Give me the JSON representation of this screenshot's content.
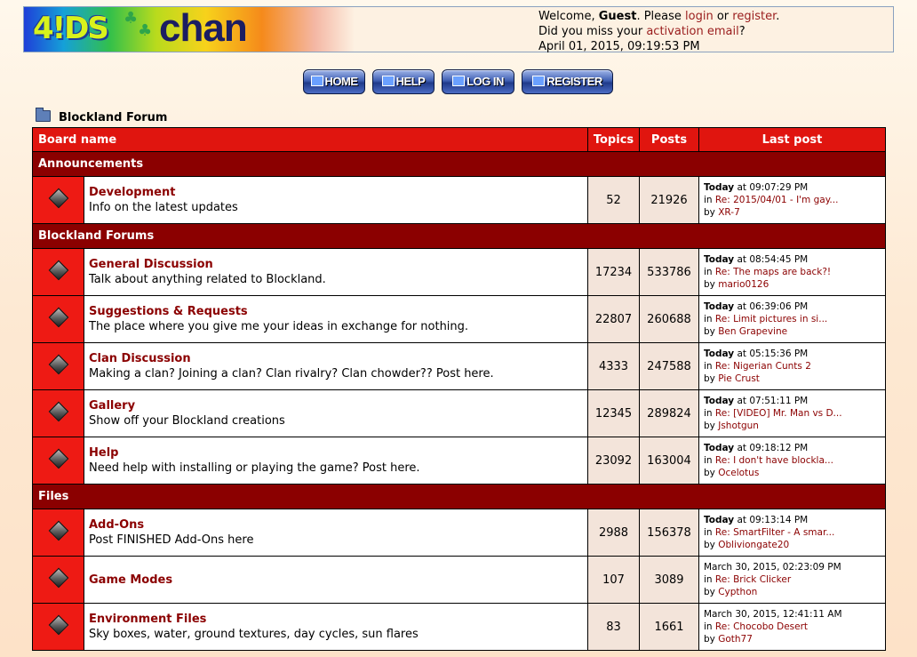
{
  "header": {
    "logo_text_1": "4!DS",
    "logo_text_2": "chan",
    "welcome_prefix": "Welcome, ",
    "user": "Guest",
    "please": ". Please ",
    "login": "login",
    "or": " or ",
    "register": "register",
    "period": ".",
    "missed": "Did you miss your ",
    "activation": "activation email",
    "question": "?",
    "datetime": "April 01, 2015, 09:19:53 PM"
  },
  "nav": {
    "home": "HOME",
    "help": "HELP",
    "login": "LOG IN",
    "register": "REGISTER"
  },
  "breadcrumb": "Blockland Forum",
  "columns": {
    "board": "Board name",
    "topics": "Topics",
    "posts": "Posts",
    "last": "Last post"
  },
  "categories": [
    {
      "name": "Announcements",
      "boards": [
        {
          "name": "Development",
          "desc": "Info on the latest updates",
          "topics": "52",
          "posts": "21926",
          "when_bold": "Today",
          "when": " at 09:07:29 PM",
          "re": "Re: 2015/04/01 - I'm gay...",
          "by": "XR-7"
        }
      ]
    },
    {
      "name": "Blockland Forums",
      "boards": [
        {
          "name": "General Discussion",
          "desc": "Talk about anything related to Blockland.",
          "topics": "17234",
          "posts": "533786",
          "when_bold": "Today",
          "when": " at 08:54:45 PM",
          "re": "Re: The maps are back?!",
          "by": "mario0126"
        },
        {
          "name": "Suggestions & Requests",
          "desc": "The place where you give me your ideas in exchange for nothing.",
          "topics": "22807",
          "posts": "260688",
          "when_bold": "Today",
          "when": " at 06:39:06 PM",
          "re": "Re: Limit pictures in si...",
          "by": "Ben Grapevine"
        },
        {
          "name": "Clan Discussion",
          "desc": "Making a clan? Joining a clan? Clan rivalry? Clan chowder?? Post here.",
          "topics": "4333",
          "posts": "247588",
          "when_bold": "Today",
          "when": " at 05:15:36 PM",
          "re": "Re: Nigerian Cunts 2",
          "by": "Pie Crust"
        },
        {
          "name": "Gallery",
          "desc": "Show off your Blockland creations",
          "topics": "12345",
          "posts": "289824",
          "when_bold": "Today",
          "when": " at 07:51:11 PM",
          "re": "Re: [VIDEO] Mr. Man vs D...",
          "by": "Jshotgun"
        },
        {
          "name": "Help",
          "desc": "Need help with installing or playing the game? Post here.",
          "topics": "23092",
          "posts": "163004",
          "when_bold": "Today",
          "when": " at 09:18:12 PM",
          "re": "Re: I don't have blockla...",
          "by": "Ocelotus"
        }
      ]
    },
    {
      "name": "Files",
      "boards": [
        {
          "name": "Add-Ons",
          "desc": "Post FINISHED Add-Ons here",
          "topics": "2988",
          "posts": "156378",
          "when_bold": "Today",
          "when": " at 09:13:14 PM",
          "re": "Re: SmartFilter - A smar...",
          "by": "Obliviongate20"
        },
        {
          "name": "Game Modes",
          "desc": "",
          "topics": "107",
          "posts": "3089",
          "when_bold": "",
          "when": "March 30, 2015, 02:23:09 PM",
          "re": "Re: Brick Clicker",
          "by": "Cypthon"
        },
        {
          "name": "Environment Files",
          "desc": "Sky boxes, water, ground textures, day cycles, sun flares",
          "topics": "83",
          "posts": "1661",
          "when_bold": "",
          "when": "March 30, 2015, 12:41:11 AM",
          "re": "Re: Chocobo Desert",
          "by": "Goth77"
        }
      ]
    }
  ],
  "lp_labels": {
    "in": "in ",
    "by": "by "
  }
}
